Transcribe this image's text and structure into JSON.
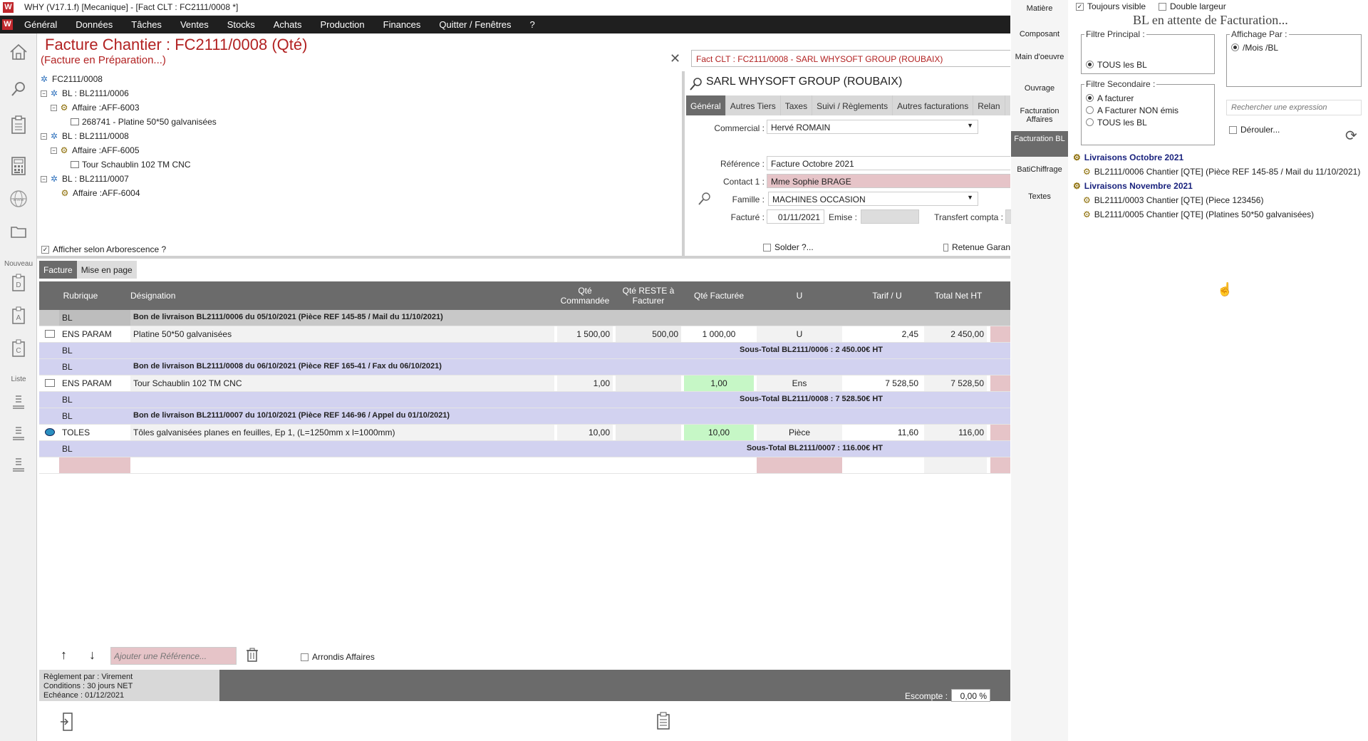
{
  "window": {
    "title": "WHY (V17.1.f)  [Mecanique] - [Fact CLT : FC2111/0008 *]",
    "logo": "W"
  },
  "menu": [
    "Général",
    "Données",
    "Tâches",
    "Ventes",
    "Stocks",
    "Achats",
    "Production",
    "Finances",
    "Quitter / Fenêtres",
    "?"
  ],
  "leftbar": {
    "section_new": "Nouveau",
    "section_list": "Liste"
  },
  "invoice": {
    "title": "Facture Chantier : FC2111/0008 (Qté)",
    "status": "(Facture en Préparation...)",
    "customer_field": "Fact CLT : FC2111/0008 - SARL WHYSOFT GROUP  (ROUBAIX)"
  },
  "tree": {
    "root": "FC2111/0008",
    "nodes": [
      {
        "label": "BL : BL2111/0006",
        "level": 1,
        "icon": "bl-icon"
      },
      {
        "label": "Affaire :AFF-6003",
        "level": 2,
        "icon": "affaire-icon"
      },
      {
        "label": "268741 - Platine 50*50 galvanisées",
        "level": 3,
        "icon": "article-icon"
      },
      {
        "label": "BL : BL2111/0008",
        "level": 1,
        "icon": "bl-icon"
      },
      {
        "label": "Affaire :AFF-6005",
        "level": 2,
        "icon": "affaire-icon"
      },
      {
        "label": "Tour Schaublin 102 TM CNC",
        "level": 3,
        "icon": "article-icon"
      },
      {
        "label": "BL : BL2111/0007",
        "level": 1,
        "icon": "bl-icon"
      },
      {
        "label": "Affaire :AFF-6004",
        "level": 2,
        "icon": "affaire-icon"
      }
    ],
    "checkbox_label": "Afficher selon Arborescence ?"
  },
  "customer": {
    "name": "SARL WHYSOFT GROUP  (ROUBAIX)",
    "tabs": [
      "Général",
      "Autres Tiers",
      "Taxes",
      "Suivi / Règlements",
      "Autres facturations",
      "Relan"
    ],
    "commercial_label": "Commercial :",
    "commercial": "Hervé ROMAIN",
    "reference_label": "Référence :",
    "reference": "Facture Octobre 2021",
    "contact_label": "Contact 1 :",
    "contact": "Mme Sophie BRAGE",
    "famille_label": "Famille :",
    "famille": "MACHINES OCCASION",
    "facture_label": "Facturé :",
    "facture_date": "01/11/2021",
    "emise_label": "Emise :",
    "transfert_label": "Transfert compta :",
    "solder_label": "Solder ?...",
    "retenue_label": "Retenue Garan"
  },
  "grid": {
    "tabs": [
      "Facture",
      "Mise en page"
    ],
    "columns": [
      "Rubrique",
      "Désignation",
      "Qté Commandée",
      "Qté RESTE à Facturer",
      "Qté Facturée",
      "U",
      "Tarif / U",
      "Total Net HT"
    ],
    "rows": [
      {
        "type": "head",
        "rubrique": "BL",
        "designation": "Bon de livraison BL2111/0006 du 05/10/2021 (Pièce REF 145-85 / Mail du 11/10/2021)"
      },
      {
        "type": "item",
        "icon": "folder",
        "rubrique": "ENS PARAM",
        "designation": "Platine 50*50 galvanisées",
        "qte_cmd": "1 500,00",
        "qte_reste": "500,00",
        "qte_fact": "1 000,00",
        "u": "U",
        "tarif": "2,45",
        "total": "2 450,00",
        "highlight": false
      },
      {
        "type": "bl",
        "rubrique": "BL",
        "subtotal": "Sous-Total BL2111/0006 : 2 450.00€ HT"
      },
      {
        "type": "bl-head",
        "rubrique": "BL",
        "designation": "Bon de livraison BL2111/0008 du 06/10/2021 (Pièce REF 165-41 / Fax du 06/10/2021)"
      },
      {
        "type": "item",
        "icon": "folder",
        "rubrique": "ENS PARAM",
        "designation": "Tour Schaublin 102 TM CNC",
        "qte_cmd": "1,00",
        "qte_reste": "",
        "qte_fact": "1,00",
        "u": "Ens",
        "tarif": "7 528,50",
        "total": "7 528,50",
        "highlight": true
      },
      {
        "type": "bl",
        "rubrique": "BL",
        "subtotal": "Sous-Total BL2111/0008 : 7 528.50€ HT"
      },
      {
        "type": "bl-head",
        "rubrique": "BL",
        "designation": "Bon de livraison BL2111/0007 du 10/10/2021 (Pièce REF 146-96 / Appel du 01/10/2021)"
      },
      {
        "type": "item",
        "icon": "eye",
        "rubrique": "TOLES",
        "designation": "Tôles galvanisées planes en feuilles, Ep 1,  (L=1250mm x l=1000mm)",
        "qte_cmd": "10,00",
        "qte_reste": "",
        "qte_fact": "10,00",
        "u": "Pièce",
        "tarif": "11,60",
        "total": "116,00",
        "highlight": true
      },
      {
        "type": "bl",
        "rubrique": "BL",
        "subtotal": "Sous-Total BL2111/0007 : 116.00€ HT"
      },
      {
        "type": "empty"
      }
    ]
  },
  "bottom": {
    "add_ref_placeholder": "Ajouter une Référence...",
    "arrondis_label": "Arrondis Affaires",
    "payment_line1": "Règlement par : Virement",
    "payment_line2": "Conditions : 30 jours NET",
    "payment_line3": "Echéance : 01/12/2021",
    "escompte_label": "Escompte :",
    "escompte_value": "0,00 %"
  },
  "rightnav": [
    "Matière",
    "Composant",
    "Main d'oeuvre",
    "Ouvrage",
    "Facturation Affaires",
    "Facturation BL",
    "BatiChiffrage",
    "Textes"
  ],
  "rightpanel": {
    "toujours_visible": "Toujours visible",
    "double_largeur": "Double largeur",
    "title": "BL en attente de Facturation...",
    "filtre_principal": "Filtre Principal :",
    "filtre_principal_opt": "TOUS les BL",
    "affichage_par": "Affichage Par :",
    "affichage_opt": "/Mois /BL",
    "filtre_secondaire": "Filtre Secondaire :",
    "filtre_sec_opts": [
      "A facturer",
      "A Facturer NON émis",
      "TOUS les BL"
    ],
    "search_placeholder": "Rechercher une expression",
    "derouler": "Dérouler...",
    "groups": [
      {
        "label": "Livraisons Octobre 2021",
        "items": [
          "BL2111/0006 Chantier [QTE] (Pièce REF 145-85 / Mail du 11/10/2021)"
        ]
      },
      {
        "label": "Livraisons Novembre 2021",
        "items": [
          "BL2111/0003 Chantier [QTE] (Piece 123456)",
          "BL2111/0005 Chantier [QTE] (Platines 50*50 galvanisées)"
        ]
      }
    ]
  }
}
